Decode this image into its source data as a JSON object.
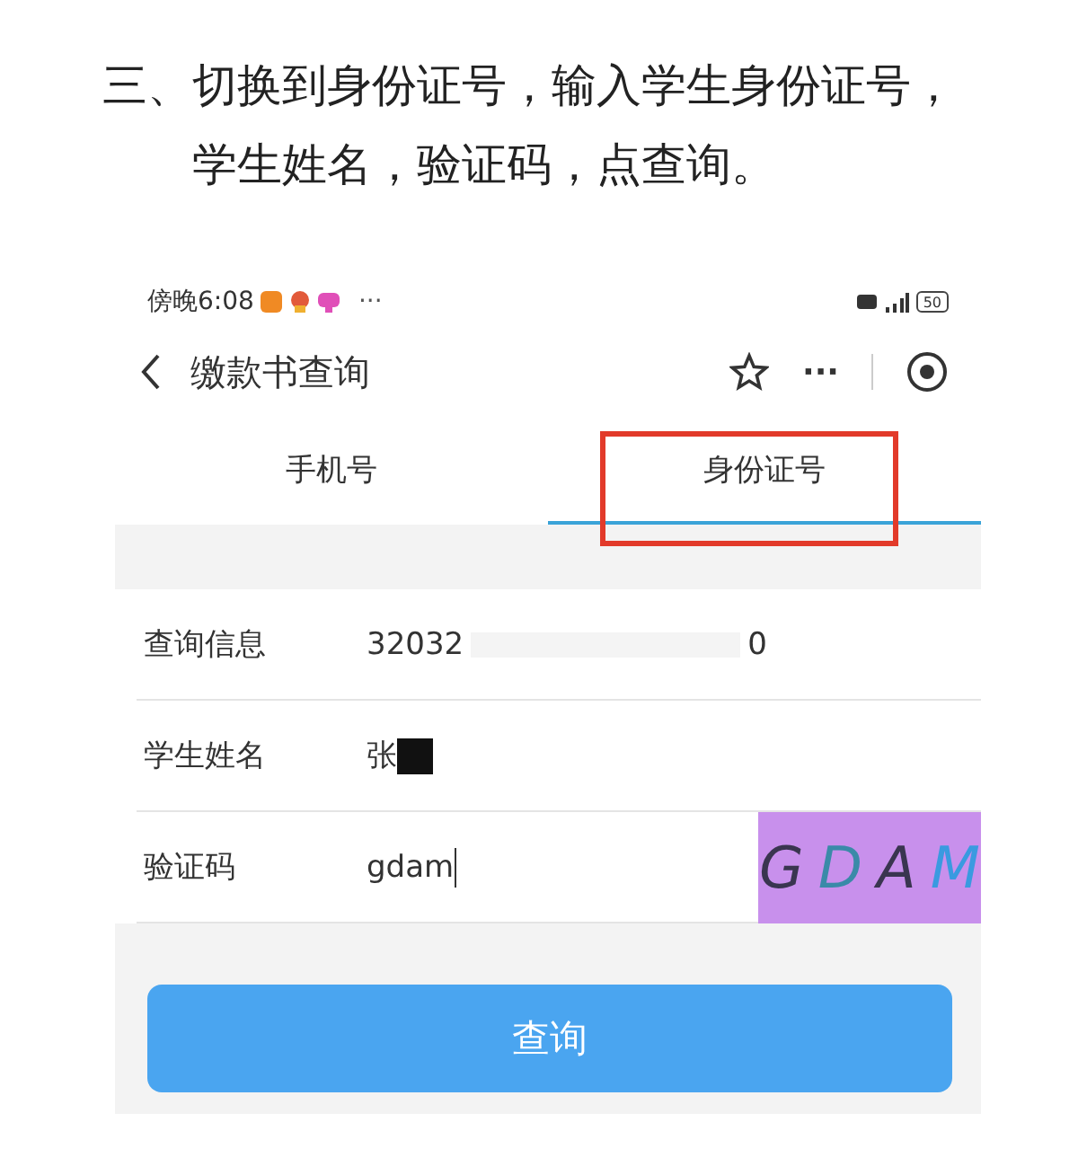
{
  "instruction": "三、切换到身份证号，输入学生身份证号，学生姓名，验证码，点查询。",
  "status_bar": {
    "time": "傍晚6:08",
    "more": "···",
    "battery": "50"
  },
  "nav": {
    "title": "缴款书查询",
    "more": "···"
  },
  "tabs": [
    {
      "label": "手机号",
      "selected": false,
      "highlighted": false
    },
    {
      "label": "身份证号",
      "selected": true,
      "highlighted": true
    }
  ],
  "fields": [
    {
      "kind": "redacted",
      "label": "查询信息",
      "value": "32032",
      "value_end": "0"
    },
    {
      "kind": "masked",
      "label": "学生姓名",
      "value": "张"
    },
    {
      "kind": "captcha",
      "label": "验证码",
      "value": "gdam",
      "captcha": "GDAM"
    }
  ],
  "submit": "查询"
}
